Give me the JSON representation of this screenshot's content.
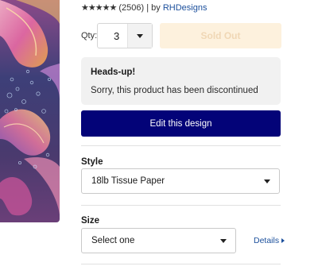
{
  "product": {
    "stars": "★★★★★",
    "review_count": "(2506)",
    "by_text": "| by",
    "designer": "RHDesigns"
  },
  "quantity": {
    "label": "Qty:",
    "value": "3"
  },
  "sold_out_label": "Sold Out",
  "notice": {
    "title": "Heads-up!",
    "message": "Sorry, this product has been discontinued"
  },
  "edit_button_label": "Edit this design",
  "style": {
    "label": "Style",
    "value": "18lb Tissue Paper"
  },
  "size": {
    "label": "Size",
    "value": "Select one",
    "details_link": "Details"
  },
  "colors": {
    "edit_button": "#030378",
    "sold_out_bg": "#fdf1dd",
    "link": "#1b4f9c",
    "notice_bg": "#f1f1f1"
  },
  "icons": [
    "dropdown-caret-icon",
    "details-arrow-icon"
  ]
}
